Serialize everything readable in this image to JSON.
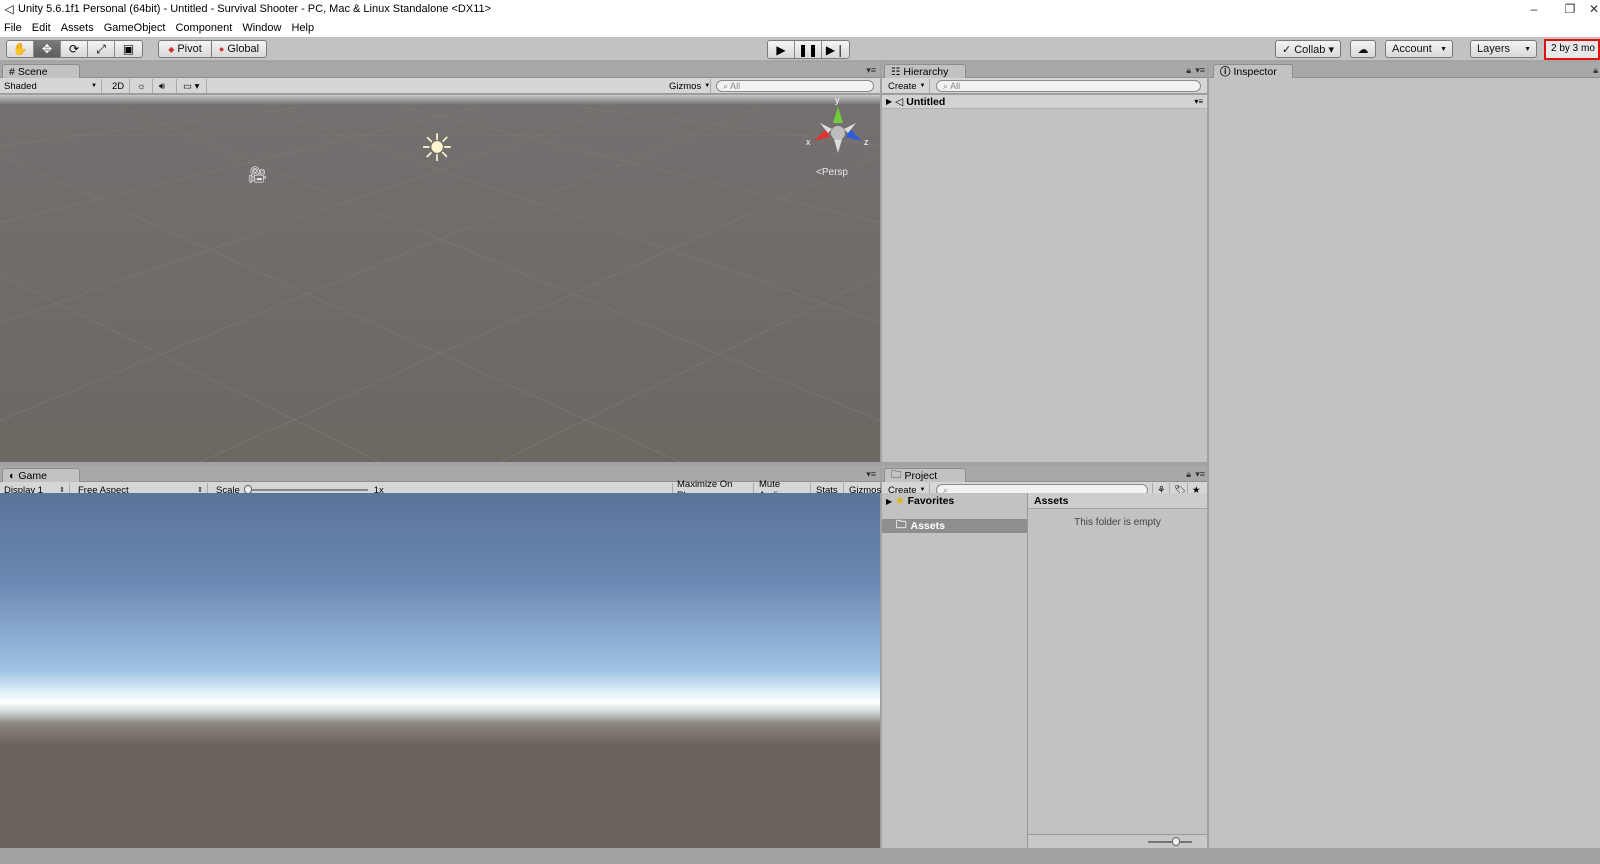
{
  "window": {
    "title": "Unity 5.6.1f1 Personal (64bit) - Untitled - Survival Shooter - PC, Mac & Linux Standalone <DX11>",
    "minimize_glyph": "–",
    "restore_glyph": "❐",
    "close_glyph": "✕"
  },
  "menu": [
    "File",
    "Edit",
    "Assets",
    "GameObject",
    "Component",
    "Window",
    "Help"
  ],
  "toolbar": {
    "tools": [
      "hand-tool",
      "move-tool",
      "rotate-tool",
      "scale-tool",
      "rect-tool"
    ],
    "pivot_label": "Pivot",
    "global_label": "Global",
    "collab_label": "Collab ▾",
    "account_label": "Account",
    "layers_label": "Layers",
    "layout_label": "2 by 3 mo"
  },
  "scene": {
    "tab_label": "Scene",
    "shading_mode": "Shaded",
    "mode_2d": "2D",
    "gizmos_label": "Gizmos",
    "search_placeholder": "All",
    "persp_label": "Persp",
    "axis_y": "y",
    "axis_x": "x",
    "axis_z": "z"
  },
  "game": {
    "tab_label": "Game",
    "display": "Display 1",
    "aspect": "Free Aspect",
    "scale_label": "Scale",
    "scale_value": "1x",
    "maximize_label": "Maximize On Play",
    "mute_label": "Mute Audio",
    "stats_label": "Stats",
    "gizmos_label": "Gizmos"
  },
  "hierarchy": {
    "tab_label": "Hierarchy",
    "create_label": "Create",
    "search_placeholder": "All",
    "scene_name": "Untitled"
  },
  "project": {
    "tab_label": "Project",
    "create_label": "Create",
    "favorites_label": "Favorites",
    "assets_label": "Assets",
    "folder_header": "Assets",
    "empty_message": "This folder is empty"
  },
  "inspector": {
    "tab_label": "Inspector"
  },
  "colors": {
    "layout_highlight": "#e01010",
    "panel_bg": "#c2c2c2",
    "selected_row": "#8e8e8e"
  }
}
